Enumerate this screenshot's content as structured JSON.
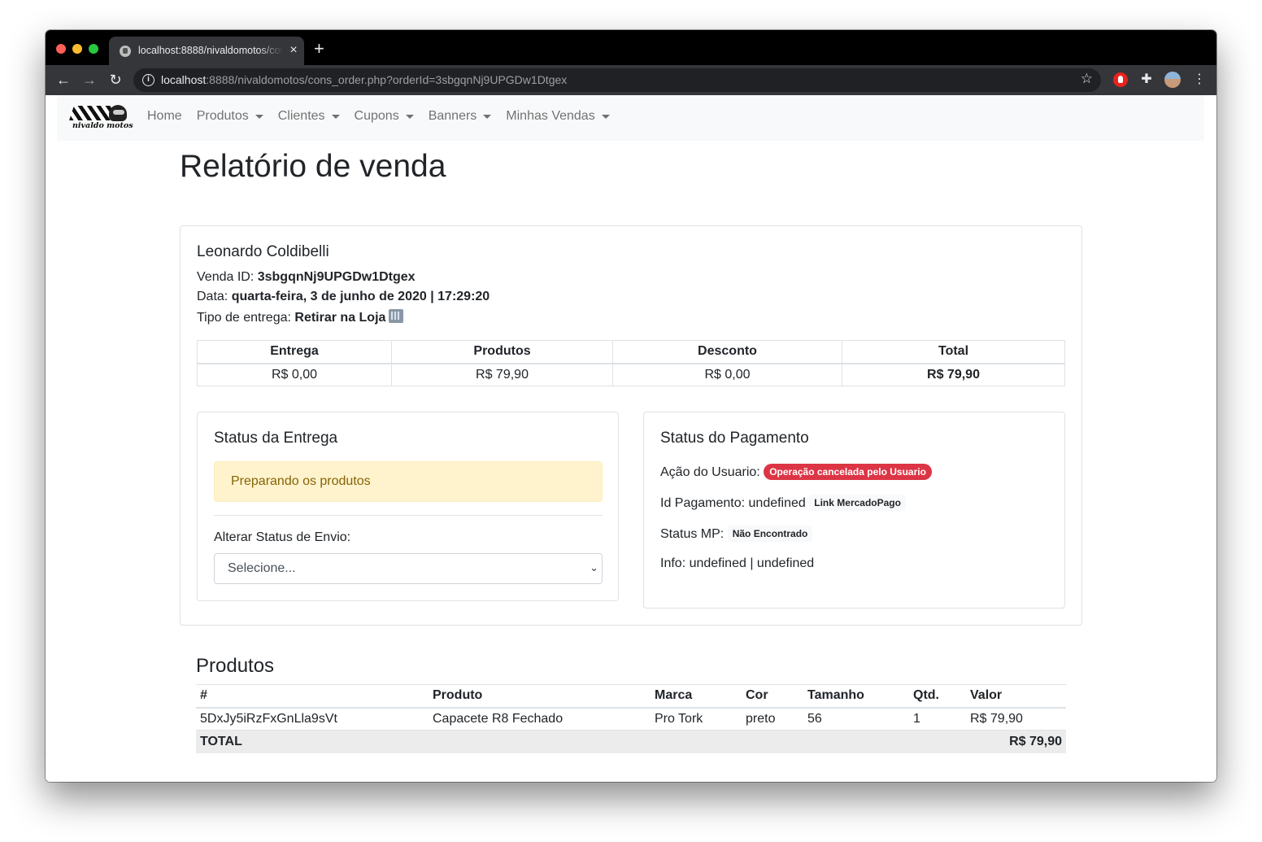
{
  "browser": {
    "tab_title": "localhost:8888/nivaldomotos/cons_order.php?orderId=3sbgqnNj9UPGDw1Dtgex",
    "url_host": "localhost",
    "url_rest": ":8888/nivaldomotos/cons_order.php?orderId=3sbgqnNj9UPGDw1Dtgex"
  },
  "navbar": {
    "brand_text": "nivaldo motos",
    "items": [
      {
        "label": "Home",
        "dropdown": false
      },
      {
        "label": "Produtos",
        "dropdown": true
      },
      {
        "label": "Clientes",
        "dropdown": true
      },
      {
        "label": "Cupons",
        "dropdown": true
      },
      {
        "label": "Banners",
        "dropdown": true
      },
      {
        "label": "Minhas Vendas",
        "dropdown": true
      }
    ]
  },
  "page_title": "Relatório de venda",
  "order": {
    "customer_name": "Leonardo Coldibelli",
    "venda_label": "Venda ID:",
    "venda_id": "3sbgqnNj9UPGDw1Dtgex",
    "data_label": "Data:",
    "data_value": "quarta-feira, 3 de junho de 2020 | 17:29:20",
    "entrega_label": "Tipo de entrega:",
    "entrega_value": "Retirar na Loja"
  },
  "summary": {
    "headers": [
      "Entrega",
      "Produtos",
      "Desconto",
      "Total"
    ],
    "values": [
      "R$ 0,00",
      "R$ 79,90",
      "R$ 0,00",
      "R$ 79,90"
    ]
  },
  "shipping_status": {
    "title": "Status da Entrega",
    "alert": "Preparando os produtos",
    "select_label": "Alterar Status de Envio:",
    "select_value": "Selecione..."
  },
  "payment_status": {
    "title": "Status do Pagamento",
    "acao_label": "Ação do Usuario:",
    "acao_badge": "Operação cancelada pelo Usuario",
    "id_label": "Id Pagamento: undefined",
    "id_link": "Link MercadoPago",
    "status_label": "Status MP:",
    "status_badge": "Não Encontrado",
    "info": "Info: undefined | undefined"
  },
  "products": {
    "title": "Produtos",
    "headers": [
      "#",
      "Produto",
      "Marca",
      "Cor",
      "Tamanho",
      "Qtd.",
      "Valor"
    ],
    "rows": [
      [
        "5DxJy5iRzFxGnLla9sVt",
        "Capacete R8 Fechado",
        "Pro Tork",
        "preto",
        "56",
        "1",
        "R$ 79,90"
      ]
    ],
    "total_label": "TOTAL",
    "total_value": "R$ 79,90"
  },
  "colors": {
    "danger": "#dc3545",
    "warning_bg": "#fff3cd",
    "warning_text": "#856404",
    "navbar_bg": "#f8f9fa"
  }
}
